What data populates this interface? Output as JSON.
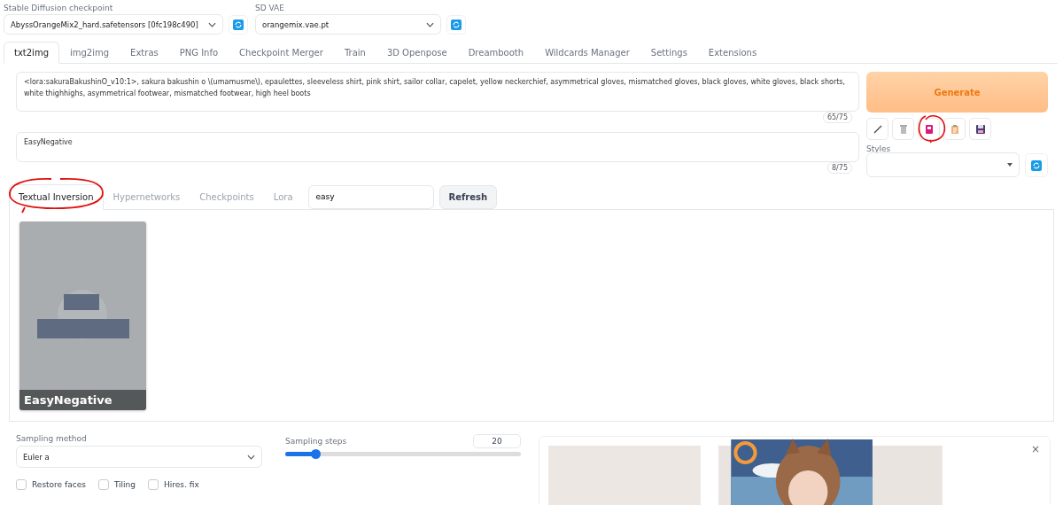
{
  "top_selects": [
    {
      "label": "Stable Diffusion checkpoint",
      "value": "AbyssOrangeMix2_hard.safetensors [0fc198c490]"
    },
    {
      "label": "SD VAE",
      "value": "orangemix.vae.pt"
    }
  ],
  "tabs": [
    {
      "label": "txt2img",
      "selected": true
    },
    {
      "label": "img2img",
      "selected": false
    },
    {
      "label": "Extras",
      "selected": false
    },
    {
      "label": "PNG Info",
      "selected": false
    },
    {
      "label": "Checkpoint Merger",
      "selected": false
    },
    {
      "label": "Train",
      "selected": false
    },
    {
      "label": "3D Openpose",
      "selected": false
    },
    {
      "label": "Dreambooth",
      "selected": false
    },
    {
      "label": "Wildcards Manager",
      "selected": false
    },
    {
      "label": "Settings",
      "selected": false
    },
    {
      "label": "Extensions",
      "selected": false
    }
  ],
  "prompt": {
    "value": "<lora:sakuraBakushinO_v10:1>, sakura bakushin o \\(umamusme\\), epaulettes, sleeveless shirt, pink shirt, sailor collar, capelet, yellow neckerchief, asymmetrical gloves, mismatched gloves, black gloves, white gloves, black shorts, white thighhighs, asymmetrical footwear, mismatched footwear, high heel boots",
    "token_count": "65/75"
  },
  "negative_prompt": {
    "value": "EasyNegative",
    "token_count": "8/75"
  },
  "generate_button": "Generate",
  "tool_buttons": [
    {
      "kind": "pencil"
    },
    {
      "kind": "trash"
    },
    {
      "kind": "card"
    },
    {
      "kind": "clipboard"
    },
    {
      "kind": "save"
    }
  ],
  "styles": {
    "label": "Styles"
  },
  "extra_tabs": [
    {
      "label": "Textual Inversion",
      "selected": true
    },
    {
      "label": "Hypernetworks",
      "selected": false
    },
    {
      "label": "Checkpoints",
      "selected": false
    },
    {
      "label": "Lora",
      "selected": false
    }
  ],
  "extra_search": {
    "value": "easy"
  },
  "refresh_button": "Refresh",
  "cards": [
    {
      "name": "EasyNegative",
      "kind": "picture"
    }
  ],
  "sampling_method": {
    "label": "Sampling method",
    "value": "Euler a"
  },
  "sampling_steps": {
    "label": "Sampling steps",
    "value": "20",
    "level": 0.13
  },
  "checkboxes": [
    {
      "label": "Restore faces",
      "checked": false
    },
    {
      "label": "Tiling",
      "checked": false
    },
    {
      "label": "Hires. fix",
      "checked": false
    }
  ],
  "output": {
    "close": "×",
    "kind": "picture"
  }
}
